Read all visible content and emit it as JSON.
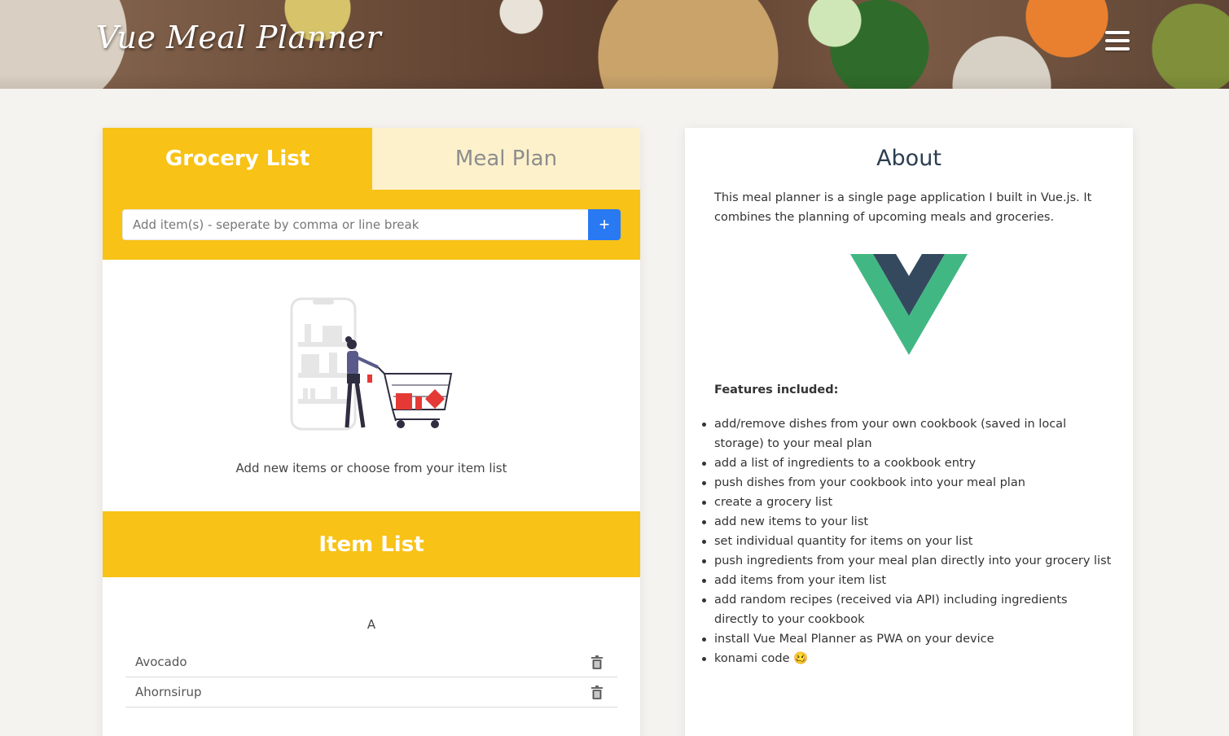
{
  "header": {
    "title": "Vue Meal Planner",
    "menu_icon": "hamburger-menu-icon"
  },
  "tabs": [
    {
      "label": "Grocery List",
      "active": true
    },
    {
      "label": "Meal Plan",
      "active": false
    }
  ],
  "add_item": {
    "placeholder": "Add item(s) - seperate by comma or line break",
    "button_label": "+"
  },
  "empty_state": {
    "text": "Add new items or choose from your item list",
    "illustration": "shopping-cart-illustration"
  },
  "item_list": {
    "title": "Item List",
    "groups": [
      {
        "letter": "A",
        "items": [
          "Avocado",
          "Ahornsirup"
        ]
      }
    ]
  },
  "about": {
    "title": "About",
    "description": "This meal planner is a single page application I built in Vue.js. It combines the planning of upcoming meals and groceries.",
    "features_title": "Features included:",
    "features": [
      "add/remove dishes from your own cookbook (saved in local storage) to your meal plan",
      "add a list of ingredients to a cookbook entry",
      "push dishes from your cookbook into your meal plan",
      "create a grocery list",
      "add new items to your list",
      "set individual quantity for items on your list",
      "push ingredients from your meal plan directly into your grocery list",
      "add items from your item list",
      "add random recipes (received via API) including ingredients directly to your cookbook",
      "install Vue Meal Planner as PWA on your device",
      "konami code 🥴"
    ]
  },
  "colors": {
    "accent": "#f8c216",
    "accent_light": "#fdf1cc",
    "button_blue": "#2979f2",
    "vue_green": "#41b883",
    "vue_dark": "#34495e"
  }
}
